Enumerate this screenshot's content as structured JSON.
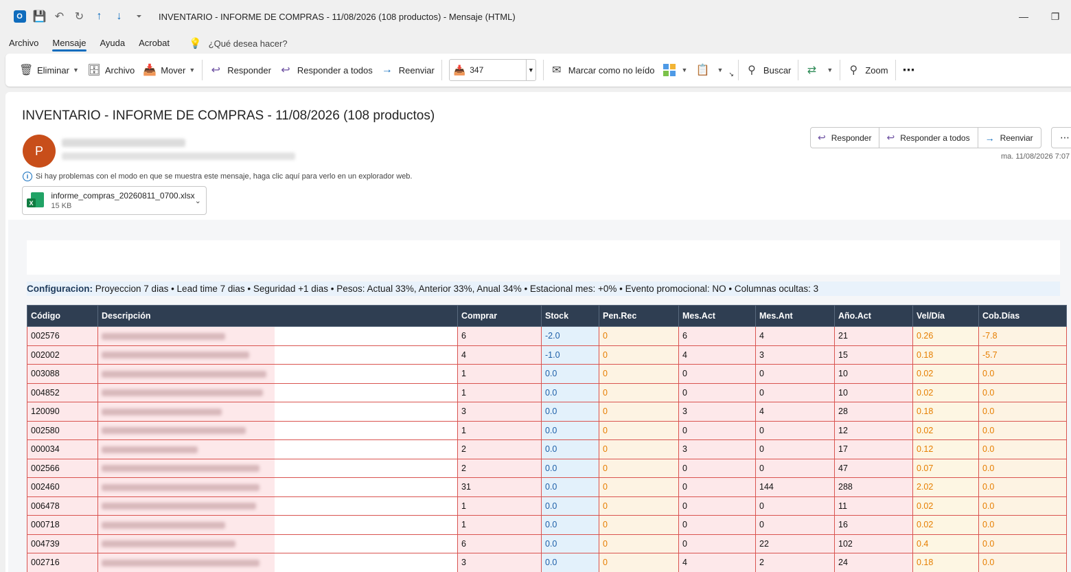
{
  "window": {
    "title": "INVENTARIO - INFORME DE COMPRAS - 11/08/2026 (108 productos)  -  Mensaje (HTML)"
  },
  "menu": {
    "tabs": [
      "Archivo",
      "Mensaje",
      "Ayuda",
      "Acrobat"
    ],
    "search_placeholder": "¿Qué desea hacer?"
  },
  "ribbon": {
    "delete": "Eliminar",
    "archive": "Archivo",
    "move": "Mover",
    "reply": "Responder",
    "reply_all": "Responder a todos",
    "forward": "Reenviar",
    "quick_value": "347",
    "mark_unread": "Marcar como no leído",
    "search": "Buscar",
    "zoom": "Zoom"
  },
  "message": {
    "subject": "INVENTARIO - INFORME DE COMPRAS - 11/08/2026 (108 productos)",
    "avatar_letter": "P",
    "info": "Si hay problemas con el modo en que se muestra este mensaje, haga clic aquí para verlo en un explorador web.",
    "date": "ma. 11/08/2026 7:07",
    "attachment": {
      "name": "informe_compras_20260811_0700.xlsx",
      "size": "15 KB"
    },
    "actions": {
      "reply": "Responder",
      "reply_all": "Responder a todos",
      "forward": "Reenviar"
    }
  },
  "report": {
    "config_label": "Configuracion:",
    "config_text": "Proyeccion 7 dias • Lead time 7 dias • Seguridad +1 dias • Pesos: Actual 33%, Anterior 33%, Anual 34% • Estacional mes: +0% • Evento promocional: NO • Columnas ocultas: 3",
    "columns": [
      "Código",
      "Descripción",
      "Comprar",
      "Stock",
      "Pen.Rec",
      "Mes.Act",
      "Mes.Ant",
      "Año.Act",
      "Vel/Día",
      "Cob.Días"
    ],
    "rows": [
      [
        "002576",
        "6",
        "-2.0",
        "0",
        "6",
        "4",
        "21",
        "0.26",
        "-7.8"
      ],
      [
        "002002",
        "4",
        "-1.0",
        "0",
        "4",
        "3",
        "15",
        "0.18",
        "-5.7"
      ],
      [
        "003088",
        "1",
        "0.0",
        "0",
        "0",
        "0",
        "10",
        "0.02",
        "0.0"
      ],
      [
        "004852",
        "1",
        "0.0",
        "0",
        "0",
        "0",
        "10",
        "0.02",
        "0.0"
      ],
      [
        "120090",
        "3",
        "0.0",
        "0",
        "3",
        "4",
        "28",
        "0.18",
        "0.0"
      ],
      [
        "002580",
        "1",
        "0.0",
        "0",
        "0",
        "0",
        "12",
        "0.02",
        "0.0"
      ],
      [
        "000034",
        "2",
        "0.0",
        "0",
        "3",
        "0",
        "17",
        "0.12",
        "0.0"
      ],
      [
        "002566",
        "2",
        "0.0",
        "0",
        "0",
        "0",
        "47",
        "0.07",
        "0.0"
      ],
      [
        "002460",
        "31",
        "0.0",
        "0",
        "0",
        "144",
        "288",
        "2.02",
        "0.0"
      ],
      [
        "006478",
        "1",
        "0.0",
        "0",
        "0",
        "0",
        "11",
        "0.02",
        "0.0"
      ],
      [
        "000718",
        "1",
        "0.0",
        "0",
        "0",
        "0",
        "16",
        "0.02",
        "0.0"
      ],
      [
        "004739",
        "6",
        "0.0",
        "0",
        "0",
        "22",
        "102",
        "0.4",
        "0.0"
      ],
      [
        "002716",
        "3",
        "0.0",
        "0",
        "4",
        "2",
        "24",
        "0.18",
        "0.0"
      ]
    ]
  },
  "colors": {
    "accent": "#0f6cbd",
    "avatar": "#c84e1a",
    "header": "#2f3e52",
    "row_bg": "#fde8ea",
    "row_border": "#d9534f"
  }
}
